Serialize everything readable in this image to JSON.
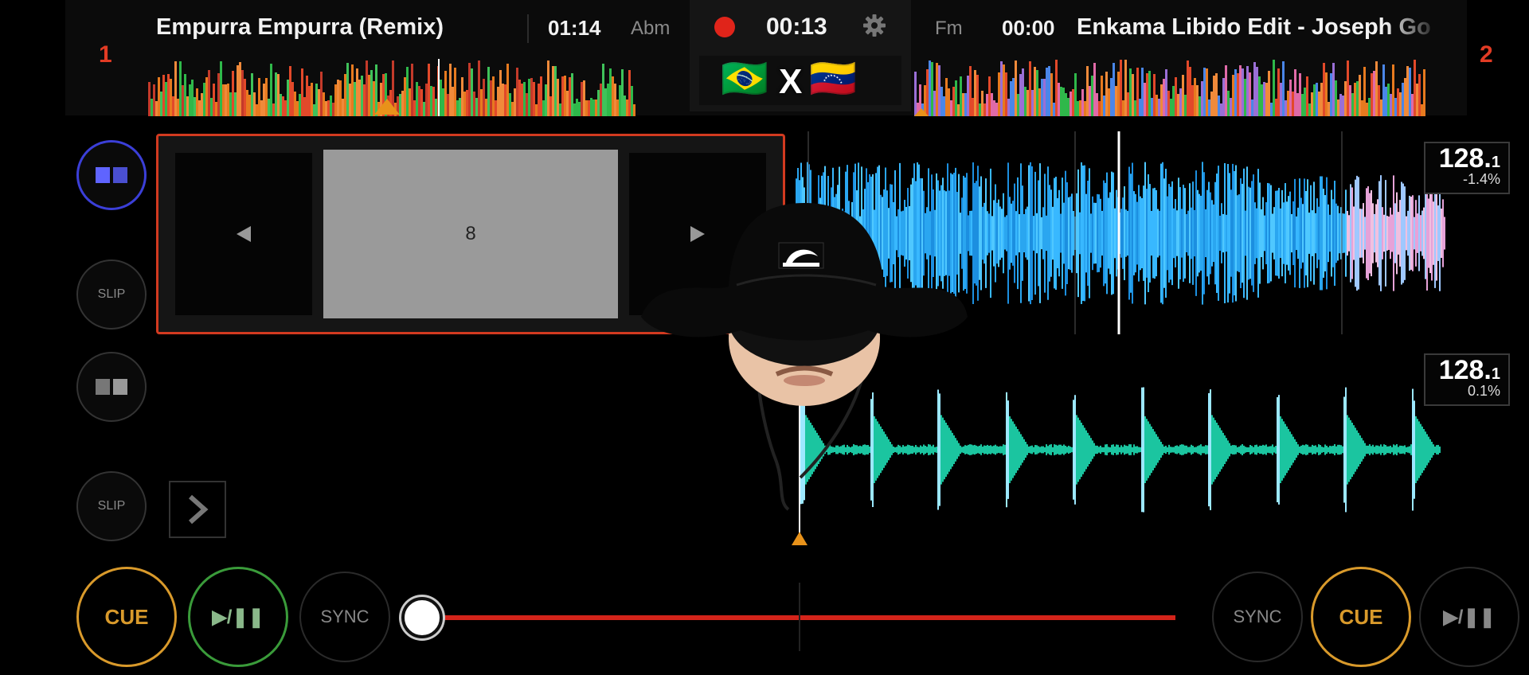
{
  "deck_left": {
    "number": "1",
    "title": "Empurra Empurra (Remix)",
    "time": "01:14",
    "key": "Abm"
  },
  "deck_right": {
    "number": "2",
    "title": "Enkama Libido Edit - Joseph Go",
    "time": "00:00",
    "key": "Fm"
  },
  "recorder": {
    "time": "00:13",
    "separator": "X",
    "flags": [
      "🇧🇷",
      "🇻🇪"
    ]
  },
  "loop_panel": {
    "value": "8",
    "prev_icon": "triangle-left-icon",
    "next_icon": "triangle-right-icon"
  },
  "side_controls": {
    "slip_label_1": "SLIP",
    "slip_label_2": "SLIP"
  },
  "bpm_top": {
    "value": "128.",
    "decimal": "1",
    "pitch": "-1.4%"
  },
  "bpm_bottom": {
    "value": "128.",
    "decimal": "1",
    "pitch": "0.1%"
  },
  "transport_left": {
    "cue": "CUE",
    "play": "▶/❚❚",
    "sync": "SYNC"
  },
  "transport_right": {
    "sync": "SYNC",
    "cue": "CUE",
    "play": "▶/❚❚"
  },
  "colors": {
    "accent_red": "#e23b24",
    "cue_gold": "#d99a2b",
    "play_green": "#3a9b3a",
    "wave_top": "#2aa6f0",
    "wave_bottom": "#1bc5a0",
    "record_red": "#e0241a"
  },
  "icons": [
    "gear-icon",
    "record-icon",
    "chevron-right-icon",
    "deck-layout-icon"
  ]
}
